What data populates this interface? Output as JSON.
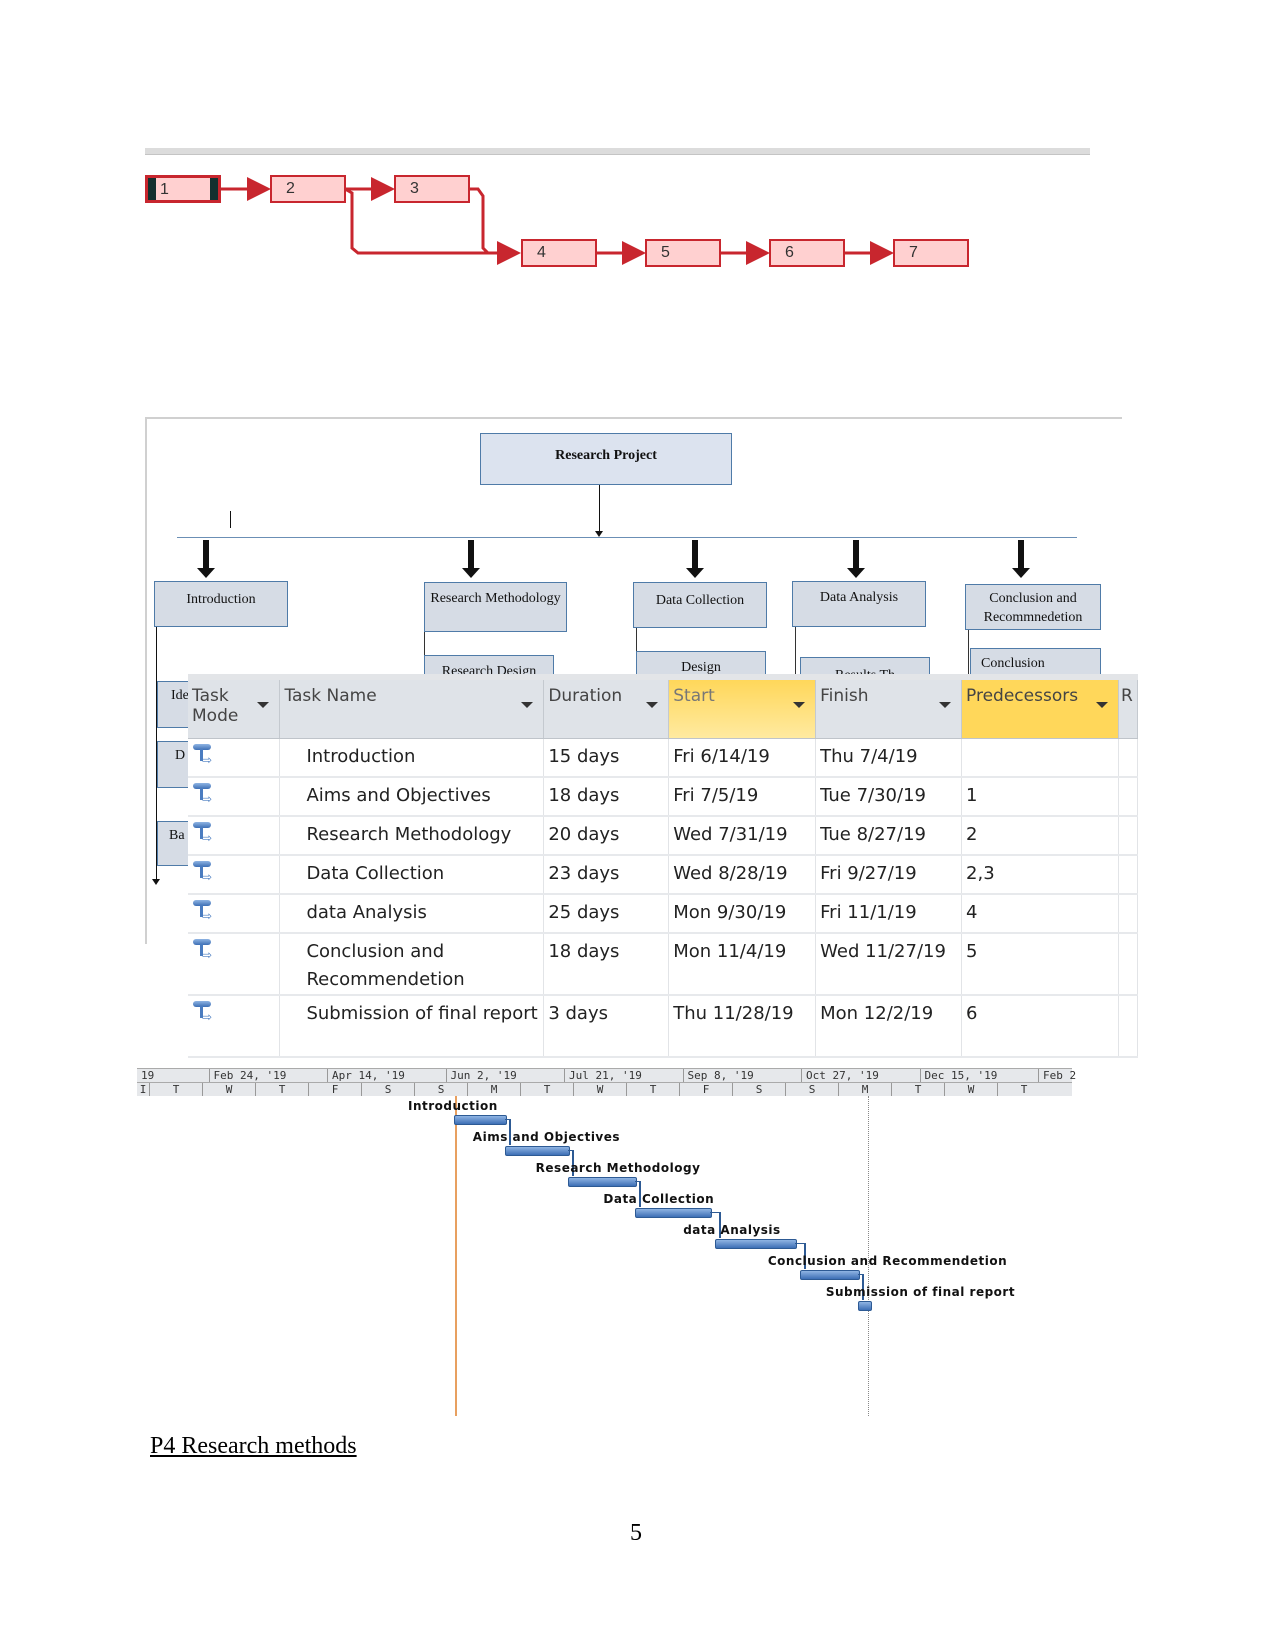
{
  "network_diagram": {
    "nodes": [
      "1",
      "2",
      "3",
      "4",
      "5",
      "6",
      "7"
    ],
    "links": [
      [
        "1",
        "2"
      ],
      [
        "2",
        "3"
      ],
      [
        "2",
        "4"
      ],
      [
        "3",
        "4"
      ],
      [
        "4",
        "5"
      ],
      [
        "5",
        "6"
      ],
      [
        "6",
        "7"
      ]
    ],
    "colors": {
      "node_fill": "#ffd0d0",
      "link": "#c8262e",
      "selected_edge": "#14302f"
    }
  },
  "wbs": {
    "root": "Research Project",
    "branches": [
      {
        "label": "Introduction",
        "children": [
          "Ide",
          "D",
          "Ba"
        ]
      },
      {
        "label": "Research Methodology",
        "children": [
          "Research Design"
        ]
      },
      {
        "label": "Data Collection",
        "children": [
          "Design"
        ]
      },
      {
        "label": "Data Analysis",
        "children": [
          "Results Th"
        ]
      },
      {
        "label": "Conclusion and Recommnedetion",
        "children": [
          "Conclusion"
        ]
      }
    ]
  },
  "task_table": {
    "columns": [
      "Task Mode",
      "Task Name",
      "Duration",
      "Start",
      "Finish",
      "Predecessors",
      "R"
    ],
    "rows": [
      {
        "mode": "auto-scheduled",
        "name": "Introduction",
        "duration": "15 days",
        "start": "Fri 6/14/19",
        "finish": "Thu 7/4/19",
        "predecessors": ""
      },
      {
        "mode": "auto-scheduled",
        "name": "Aims and Objectives",
        "duration": "18 days",
        "start": "Fri 7/5/19",
        "finish": "Tue 7/30/19",
        "predecessors": "1"
      },
      {
        "mode": "auto-scheduled",
        "name": "Research Methodology",
        "duration": "20 days",
        "start": "Wed 7/31/19",
        "finish": "Tue 8/27/19",
        "predecessors": "2"
      },
      {
        "mode": "auto-scheduled",
        "name": "Data Collection",
        "duration": "23 days",
        "start": "Wed 8/28/19",
        "finish": "Fri 9/27/19",
        "predecessors": "2,3"
      },
      {
        "mode": "auto-scheduled",
        "name": "data Analysis",
        "duration": "25 days",
        "start": "Mon 9/30/19",
        "finish": "Fri 11/1/19",
        "predecessors": "4"
      },
      {
        "mode": "auto-scheduled",
        "name": "Conclusion and Recommendetion",
        "duration": "18 days",
        "start": "Mon 11/4/19",
        "finish": "Wed 11/27/19",
        "predecessors": "5"
      },
      {
        "mode": "auto-scheduled",
        "name": "Submission of final report",
        "duration": "3 days",
        "start": "Thu 11/28/19",
        "finish": "Mon 12/2/19",
        "predecessors": "6"
      }
    ],
    "highlight_color": "#ffd75a"
  },
  "gantt": {
    "top_scale": [
      "19",
      "Feb 24, '19",
      "Apr 14, '19",
      "Jun 2, '19",
      "Jul 21, '19",
      "Sep 8, '19",
      "Oct 27, '19",
      "Dec 15, '19",
      "Feb 2"
    ],
    "bottom_scale": [
      "I",
      "T",
      "W",
      "T",
      "F",
      "S",
      "S",
      "M",
      "T",
      "W",
      "T",
      "F",
      "S",
      "S",
      "M",
      "T",
      "W",
      "T"
    ],
    "tasks": [
      {
        "label": "Introduction",
        "start": "2019-06-14",
        "finish": "2019-07-04"
      },
      {
        "label": "Aims and Objectives",
        "start": "2019-07-05",
        "finish": "2019-07-30"
      },
      {
        "label": "Research Methodology",
        "start": "2019-07-31",
        "finish": "2019-08-27"
      },
      {
        "label": "Data Collection",
        "start": "2019-08-28",
        "finish": "2019-09-27"
      },
      {
        "label": "data Analysis",
        "start": "2019-09-30",
        "finish": "2019-11-01"
      },
      {
        "label": "Conclusion and Recommendetion",
        "start": "2019-11-04",
        "finish": "2019-11-27"
      },
      {
        "label": "Submission of final report",
        "start": "2019-11-28",
        "finish": "2019-12-02"
      }
    ],
    "colors": {
      "bar": "#4f81bd",
      "today_line": "#e8a060",
      "status_line": "#888888"
    }
  },
  "section_heading": "P4 Research methods",
  "page_number": "5"
}
